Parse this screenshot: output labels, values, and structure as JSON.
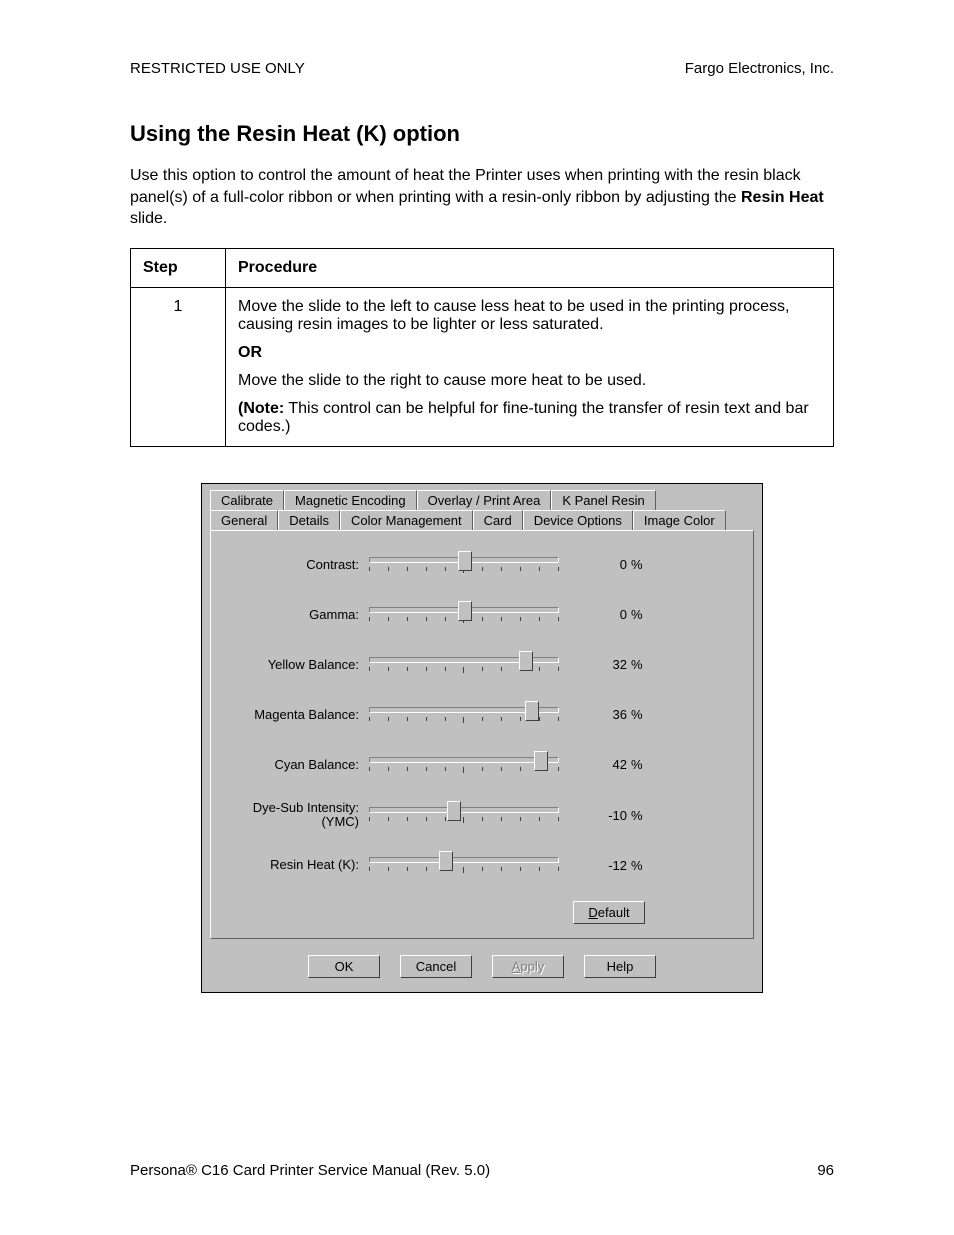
{
  "header": {
    "left": "RESTRICTED USE ONLY",
    "right": "Fargo Electronics, Inc."
  },
  "title": "Using the Resin Heat (K) option",
  "intro": {
    "p1a": "Use this option to control the amount of heat the Printer uses when printing with the resin black panel(s) of a full-color ribbon or when printing with a resin-only ribbon by adjusting the ",
    "bold": "Resin Heat",
    "p1b": " slide."
  },
  "table": {
    "head_step": "Step",
    "head_proc": "Procedure",
    "step_num": "1",
    "line1": "Move the slide to the left to cause less heat to be used in the printing process, causing resin images to be lighter or less saturated.",
    "or": "OR",
    "line2": "Move the slide to the right to cause more heat to be used.",
    "note_label": "(Note:",
    "note_body": "  This control can be helpful for fine-tuning the transfer of resin text and bar codes.)"
  },
  "dialog": {
    "tabs_row1": [
      "Calibrate",
      "Magnetic Encoding",
      "Overlay / Print Area",
      "K Panel Resin"
    ],
    "tabs_row2": [
      "General",
      "Details",
      "Color Management",
      "Card",
      "Device Options",
      "Image Color"
    ],
    "active_tab": "Image Color",
    "sliders": [
      {
        "label": "Contrast:",
        "value": "0",
        "unit": "%",
        "pos": 50
      },
      {
        "label": "Gamma:",
        "value": "0",
        "unit": "%",
        "pos": 50
      },
      {
        "label": "Yellow Balance:",
        "value": "32",
        "unit": "%",
        "pos": 82
      },
      {
        "label": "Magenta Balance:",
        "value": "36",
        "unit": "%",
        "pos": 85
      },
      {
        "label": "Cyan Balance:",
        "value": "42",
        "unit": "%",
        "pos": 90
      },
      {
        "label": "Dye-Sub Intensity:\n(YMC)",
        "value": "-10",
        "unit": "%",
        "pos": 44
      },
      {
        "label": "Resin Heat  (K):",
        "value": "-12",
        "unit": "%",
        "pos": 40
      }
    ],
    "default_btn_pre": "D",
    "default_btn_rest": "efault",
    "buttons": {
      "ok": "OK",
      "cancel": "Cancel",
      "apply_pre": "A",
      "apply_rest": "pply",
      "help": "Help"
    }
  },
  "footer": {
    "left": "Persona® C16 Card Printer Service Manual (Rev. 5.0)",
    "right": "96"
  }
}
